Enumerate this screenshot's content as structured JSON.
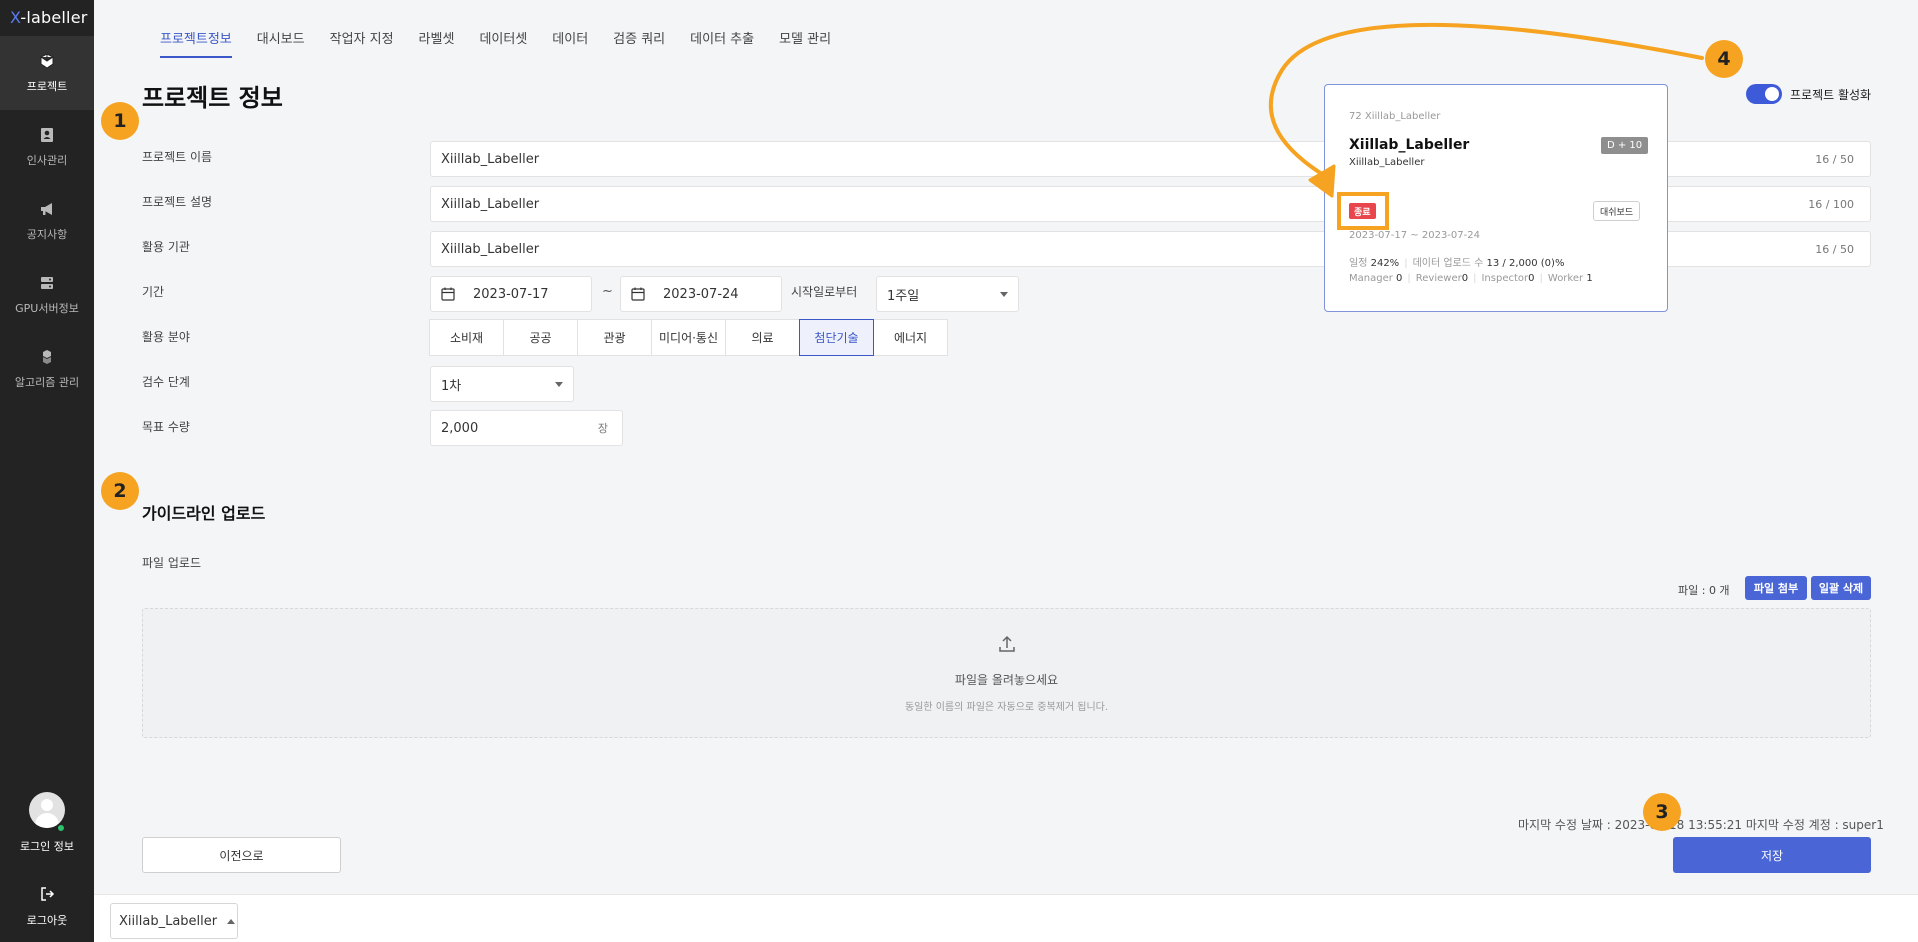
{
  "app": {
    "logo_x": "X",
    "logo_rest": "-labeller"
  },
  "sidebar": {
    "items": [
      {
        "label": "프로젝트",
        "icon": "box-icon",
        "active": true
      },
      {
        "label": "인사관리",
        "icon": "person-card-icon"
      },
      {
        "label": "공지사항",
        "icon": "megaphone-icon"
      },
      {
        "label": "GPU서버정보",
        "icon": "server-icon"
      },
      {
        "label": "알고리즘 관리",
        "icon": "boxes-icon"
      }
    ],
    "profile_label": "로그인 정보",
    "logout_label": "로그아웃"
  },
  "tabs": [
    "프로젝트정보",
    "대시보드",
    "작업자 지정",
    "라벨셋",
    "데이터셋",
    "데이터",
    "검증 쿼리",
    "데이터 추출",
    "모델 관리"
  ],
  "page": {
    "title": "프로젝트 정보",
    "toggle_label": "프로젝트 활성화",
    "toggle_on": true
  },
  "markers": [
    "1",
    "2",
    "3",
    "4"
  ],
  "form": {
    "name": {
      "label": "프로젝트 이름",
      "value": "Xiillab_Labeller",
      "counter": "16 / 50"
    },
    "desc": {
      "label": "프로젝트 설명",
      "value": "Xiillab_Labeller",
      "counter": "16 / 100"
    },
    "org": {
      "label": "활용 기관",
      "value": "Xiillab_Labeller",
      "counter": "16 / 50"
    },
    "period": {
      "label": "기간",
      "start": "2023-07-17",
      "tilde": "~",
      "end": "2023-07-24",
      "from_label": "시작일로부터",
      "duration": "1주일"
    },
    "field": {
      "label": "활용 분야",
      "options": [
        "소비재",
        "공공",
        "관광",
        "미디어·통신",
        "의료",
        "첨단기술",
        "에너지"
      ],
      "selected": "첨단기술"
    },
    "review": {
      "label": "검수 단계",
      "value": "1차"
    },
    "target": {
      "label": "목표 수량",
      "value": "2,000",
      "unit": "장"
    }
  },
  "guideline": {
    "title": "가이드라인 업로드",
    "file_label": "파일 업로드",
    "file_count": "파일 : 0 개",
    "attach_button": "파일 첨부",
    "delete_button": "일괄 삭제",
    "drop_main": "파일을 올려놓으세요",
    "drop_sub": "동일한 이름의 파일은 자동으로 중복제거 됩니다."
  },
  "footer": {
    "last_modified": "마지막 수정 날짜 : 2023-07-18 13:55:21   마지막 수정 계정 : super1",
    "prev_button": "이전으로",
    "save_button": "저장",
    "project_select": "Xiillab_Labeller"
  },
  "card": {
    "id": "72 Xiillab_Labeller",
    "title": "Xiillab_Labeller",
    "subtitle": "Xiillab_Labeller",
    "dday": "D + 10",
    "status": "종료",
    "status_color": "#e8454c",
    "dashboard_button": "대쉬보드",
    "period": "2023-07-17 ~ 2023-07-24",
    "schedule_label": "일정",
    "schedule_value": "242%",
    "upload_label": "데이터 업로드 수",
    "upload_value": "13 / 2,000 (0)%",
    "manager_label": "Manager",
    "manager_value": "0",
    "reviewer_label": "Reviewer",
    "reviewer_value": "0",
    "inspector_label": "Inspector",
    "inspector_value": "0",
    "worker_label": "Worker",
    "worker_value": "1"
  },
  "colors": {
    "accent": "#3d5bd9",
    "marker": "#f5a321",
    "sidebar": "#232323",
    "status_end": "#e8454c"
  }
}
